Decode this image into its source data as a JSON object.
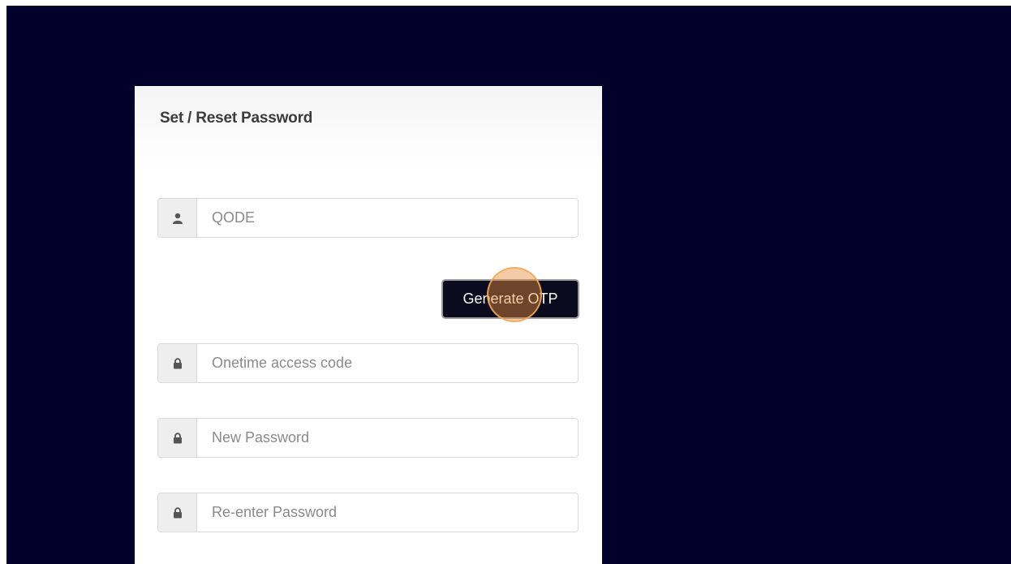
{
  "form": {
    "title": "Set / Reset Password",
    "qode_placeholder": "QODE",
    "generate_otp_label": "Generate OTP",
    "otp_placeholder": "Onetime access code",
    "new_password_placeholder": "New Password",
    "reenter_password_placeholder": "Re-enter Password"
  },
  "icons": {
    "user": "user-icon",
    "lock": "lock-icon"
  },
  "colors": {
    "background": "#02002a",
    "card": "#ffffff",
    "button": "#0b0a1e",
    "click_indicator": "#e68c3c"
  }
}
